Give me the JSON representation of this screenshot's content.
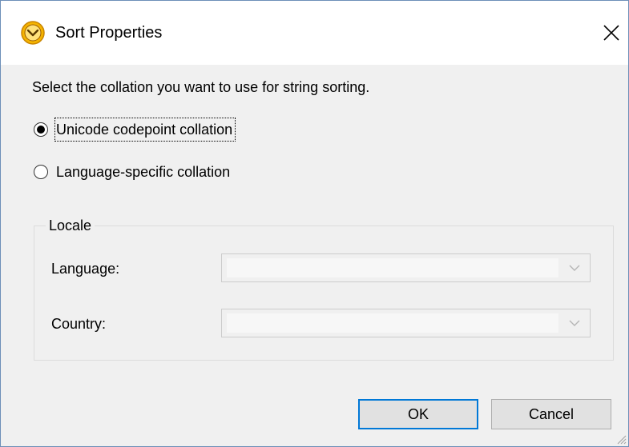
{
  "window": {
    "title": "Sort Properties",
    "icon": "altova-mapforce-icon",
    "close_glyph": "✕"
  },
  "instruction": "Select the collation you want to use for string sorting.",
  "collation_options": [
    {
      "label": "Unicode codepoint collation",
      "selected": true
    },
    {
      "label": "Language-specific collation",
      "selected": false
    }
  ],
  "locale": {
    "group_title": "Locale",
    "language_label": "Language:",
    "language_value": "",
    "country_label": "Country:",
    "country_value": ""
  },
  "buttons": {
    "ok": "OK",
    "cancel": "Cancel"
  },
  "colors": {
    "dialog_bg": "#f0f0f0",
    "focus_border": "#0078d7",
    "icon_orange": "#f5a623"
  }
}
